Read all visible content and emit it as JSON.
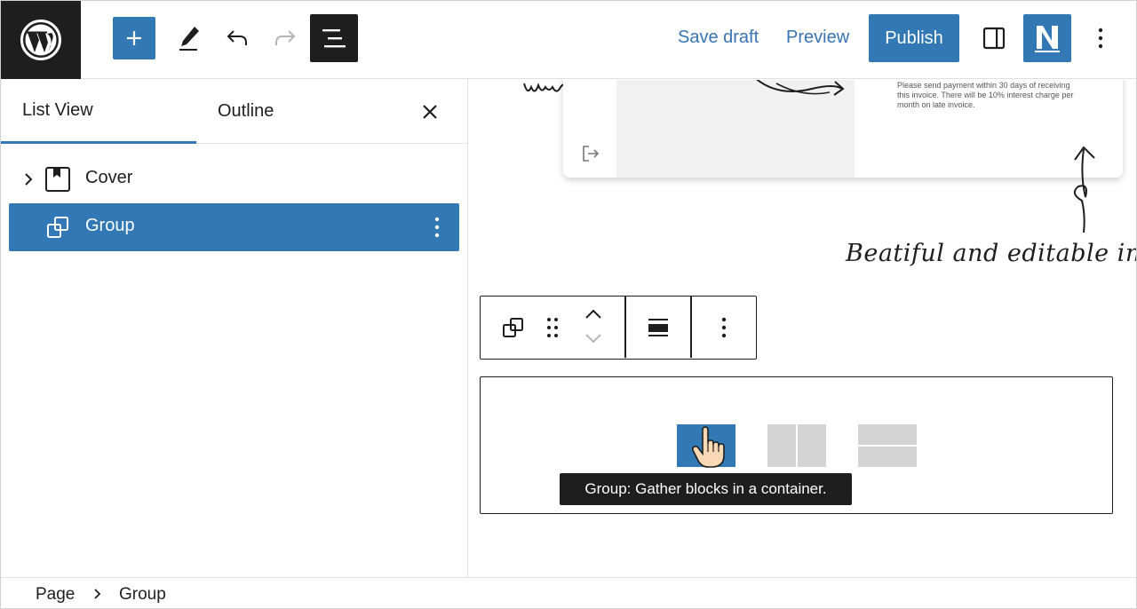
{
  "topbar": {
    "logo": "wordpress-logo",
    "add_icon": "plus-icon",
    "tools_icon": "pen-icon",
    "undo_icon": "undo-icon",
    "redo_icon": "redo-icon",
    "list_view_icon": "list-view-icon",
    "save_draft_label": "Save draft",
    "preview_label": "Preview",
    "publish_label": "Publish",
    "settings_icon": "sidebar-toggle-icon",
    "plugin_icon": "n-logo",
    "more_icon": "kebab-icon"
  },
  "panel": {
    "tabs": [
      {
        "label": "List View",
        "active": true
      },
      {
        "label": "Outline",
        "active": false
      }
    ],
    "close_icon": "close-icon",
    "tree": [
      {
        "label": "Cover",
        "icon": "cover-block-icon",
        "expandable": true,
        "selected": false
      },
      {
        "label": "Group",
        "icon": "group-block-icon",
        "expandable": false,
        "selected": true
      }
    ]
  },
  "canvas": {
    "card_note": "Please send payment within 30 days of receiving this invoice. There will be 10% interest charge per month on late invoice.",
    "script_text": "Beatiful and editable inv",
    "script_fragment": "wri",
    "block_toolbar": [
      "group-icon",
      "drag-handle-icon",
      "move-up-icon",
      "move-down-icon",
      "align-icon",
      "options-kebab-icon"
    ],
    "variations": [
      "Group",
      "Row",
      "Stack"
    ],
    "tooltip": "Group: Gather blocks in a container."
  },
  "breadcrumb": {
    "items": [
      "Page",
      "Group"
    ]
  },
  "colors": {
    "accent": "#3178b5",
    "dark": "#1e1e1e",
    "link": "#3873b3",
    "placeholder_gray": "#d4d4d4"
  }
}
